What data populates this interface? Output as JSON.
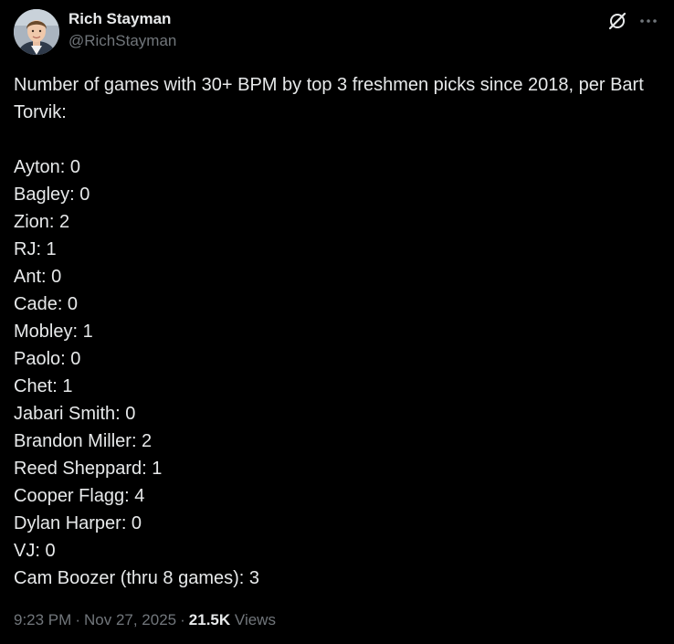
{
  "author": {
    "display_name": "Rich Stayman",
    "handle": "@RichStayman"
  },
  "header_icons": {
    "grok": "grok-icon",
    "more": "more-icon"
  },
  "tweet": {
    "intro": "Number of games with 30+ BPM by top 3 freshmen picks since 2018, per Bart Torvik:",
    "lines": [
      "Ayton: 0",
      "Bagley: 0",
      "Zion: 2",
      "RJ: 1",
      "Ant: 0",
      "Cade: 0",
      "Mobley: 1",
      "Paolo: 0",
      "Chet: 1",
      "Jabari Smith: 0",
      "Brandon Miller: 2",
      "Reed Sheppard: 1",
      "Cooper Flagg: 4",
      "Dylan Harper: 0",
      "VJ: 0",
      "Cam Boozer (thru 8 games): 3"
    ]
  },
  "meta": {
    "time": "9:23 PM",
    "separator": "·",
    "date": "Nov 27, 2025",
    "views_count": "21.5K",
    "views_label": "Views"
  },
  "colors": {
    "background": "#000000",
    "text_primary": "#e7e9ea",
    "text_secondary": "#71767b"
  }
}
